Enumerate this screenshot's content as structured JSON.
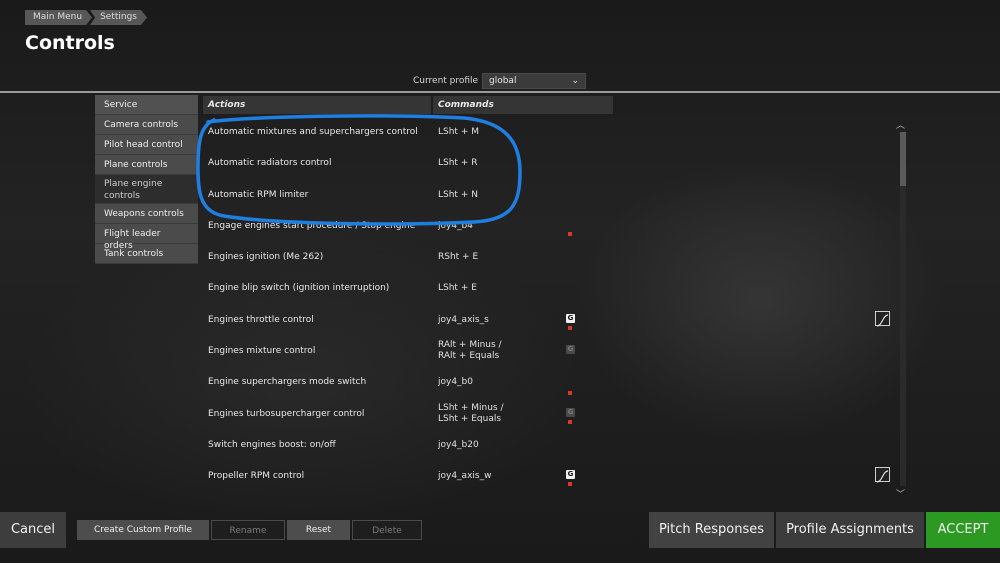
{
  "breadcrumb": [
    "Main Menu",
    "Settings"
  ],
  "title": "Controls",
  "profile": {
    "label": "Current profile",
    "value": "global"
  },
  "sidebar": {
    "items": [
      {
        "label": "Service"
      },
      {
        "label": "Camera controls"
      },
      {
        "label": "Pilot head control"
      },
      {
        "label": "Plane controls"
      },
      {
        "label": "Plane engine controls",
        "active": true
      },
      {
        "label": "Weapons controls"
      },
      {
        "label": "Flight leader orders"
      },
      {
        "label": "Tank controls"
      }
    ]
  },
  "table": {
    "headers": {
      "actions": "Actions",
      "commands": "Commands"
    },
    "rows": [
      {
        "action": "Automatic mixtures and superchargers control",
        "command": "LSht + M"
      },
      {
        "action": "Automatic radiators control",
        "command": "LSht + R"
      },
      {
        "action": "Automatic RPM limiter",
        "command": "LSht + N"
      },
      {
        "action": "Engage engines start procedure / Stop engine",
        "command": "joy4_b4"
      },
      {
        "action": "Engines ignition (Me 262)",
        "command": "RSht + E"
      },
      {
        "action": "Engine blip switch (ignition interruption)",
        "command": "LSht + E"
      },
      {
        "action": "Engines throttle control",
        "command": "joy4_axis_s"
      },
      {
        "action": "Engines mixture control",
        "command_line1": "RAlt + Minus /",
        "command_line2": "RAlt + Equals"
      },
      {
        "action": "Engine superchargers mode switch",
        "command": "joy4_b0"
      },
      {
        "action": "Engines turbosupercharger control",
        "command_line1": "LSht + Minus /",
        "command_line2": "LSht + Equals"
      },
      {
        "action": "Switch engines boost: on/off",
        "command": "joy4_b20"
      },
      {
        "action": "Propeller RPM control",
        "command": "joy4_axis_w"
      }
    ],
    "axis_icon_glyph": "G"
  },
  "buttons": {
    "cancel": "Cancel",
    "create_profile": "Create Custom Profile",
    "rename": "Rename",
    "reset": "Reset",
    "delete": "Delete",
    "pitch": "Pitch Responses",
    "assignments": "Profile Assignments",
    "accept": "ACCEPT"
  },
  "colors": {
    "accept": "#2c9a22",
    "annotation": "#1f7fe0",
    "modified_marker": "#d83a2a"
  }
}
